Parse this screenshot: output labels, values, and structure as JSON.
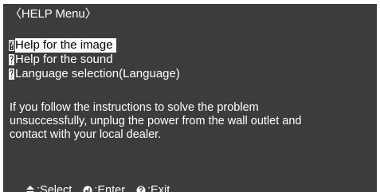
{
  "screen": {
    "title": "〈HELP Menu〉",
    "menu_items": [
      {
        "label": "Help for the image",
        "selected": true
      },
      {
        "label": "Help for the sound",
        "selected": false
      },
      {
        "label": "Language selection(Language)",
        "selected": false
      }
    ],
    "message_lines": [
      "If you follow the instructions to solve the problem",
      "unsuccessfully, unplug the power from the wall outlet and",
      "contact with your local dealer."
    ],
    "footer": {
      "select_label": ":Select",
      "enter_label": ":Enter",
      "exit_label": ":Exit",
      "select_icon": "up-down-arrows-icon",
      "enter_icon": "enter-icon",
      "exit_icon": "question-icon"
    },
    "colors": {
      "background": "#3c3c3c",
      "text": "#ffffff",
      "highlight_bg": "#ffffff",
      "highlight_text": "#000000"
    }
  }
}
